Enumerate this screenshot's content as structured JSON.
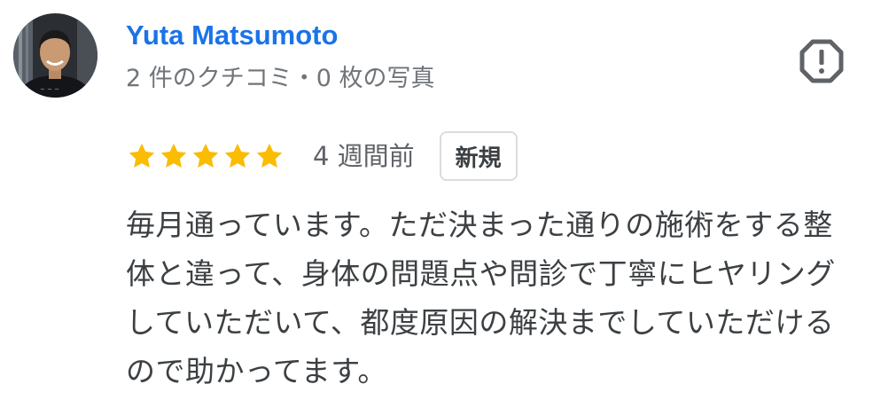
{
  "review": {
    "author": {
      "name": "Yuta Matsumoto",
      "meta": "2 件のクチコミ・0 枚の写真",
      "avatar_icon": "profile-photo"
    },
    "rating": {
      "stars": 5,
      "max_stars": 5,
      "star_color": "#fbbc04",
      "date": "4 週間前",
      "badge": "新規"
    },
    "text": "毎月通っています。ただ決まった通りの施術をする整体と違って、身体の問題点や問診で丁寧にヒヤリングしていただいて、都度原因の解決までしていただけるので助かってます。",
    "report_icon": "report-octagon-icon",
    "colors": {
      "author_name": "#1a73e8",
      "meta_text": "#70757a",
      "body_text": "#3c4043",
      "icon": "#5f6368"
    }
  }
}
